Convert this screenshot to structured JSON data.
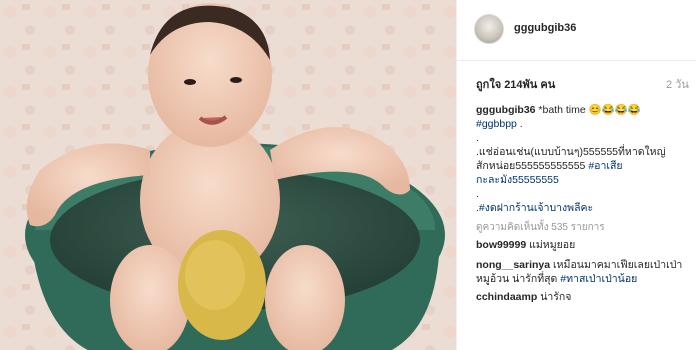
{
  "post": {
    "username": "gggubgib36",
    "likes": "ถูกใจ 214พัน คน",
    "time": "2 วัน",
    "caption": {
      "username": "gggubgib36",
      "line1": "*bath time 😊😂😂😂",
      "tag1": "#ggbbpp",
      "line1_tail": " .",
      "dot1": ".",
      "line2a": ".แช่อ่อนเช่น(แบบบ้านๆ)555555ที่หาดใหญ่",
      "line2b": "สักหน่อย555555555555 ",
      "tag2": "#อาเสีย",
      "tag2b": "กะละมัง55555555",
      "dot2": ".",
      "tag3": ".#งดฝากร้านเจ้าบางพลีคะ"
    },
    "view_all": "ดูความคิดเห็นทั้ง 535 รายการ",
    "comments": [
      {
        "username": "bow99999",
        "text": " แม่หมูยอย",
        "tag": ""
      },
      {
        "username": "nong__sarinya",
        "text": " เหมือนมาคมาเฟียเลยเป่าเป่า หมูอ้วน น่ารักที่สุด ",
        "tag": "#ทาสเป่าเป่าน้อย"
      },
      {
        "username": "cchindaamp",
        "text": " น่ารักจ",
        "tag": ""
      }
    ]
  },
  "colors": {
    "tag": "#003569",
    "basin": "#2f6b58",
    "sponge": "#d9b84a"
  }
}
